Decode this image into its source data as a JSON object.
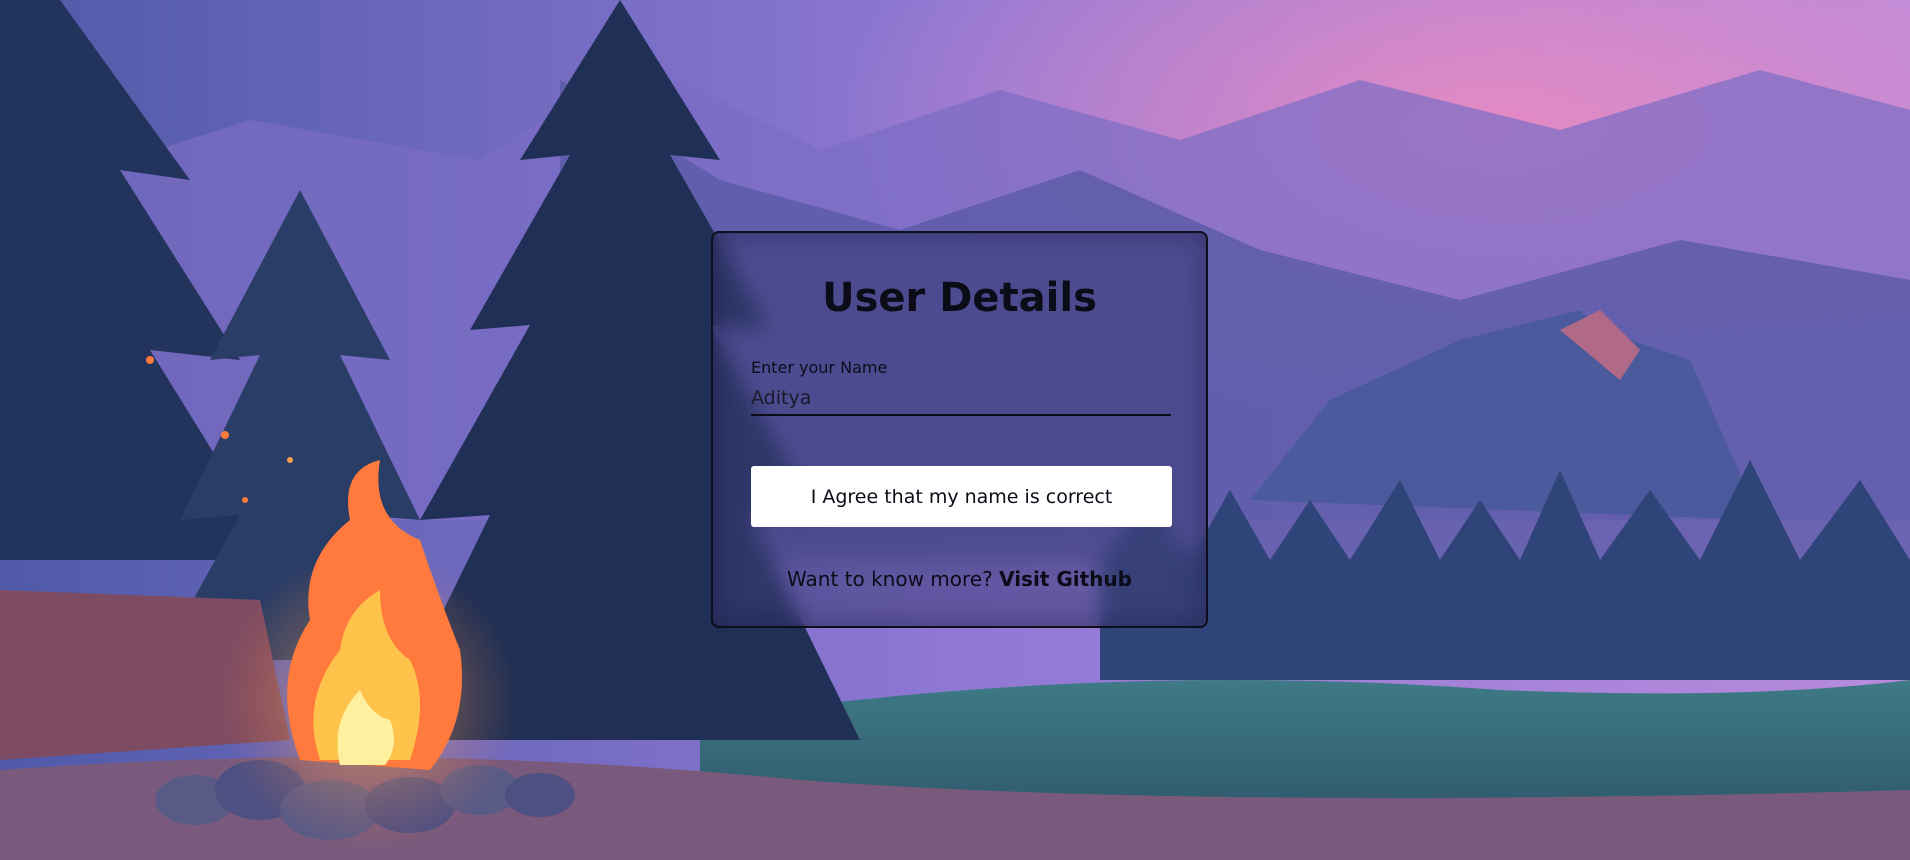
{
  "background": {
    "scene": "night forest campfire with mountains"
  },
  "card": {
    "title": "User Details",
    "name_field": {
      "label": "Enter your Name",
      "value": "Aditya"
    },
    "agree_button": "I Agree that my name is correct",
    "more_text": "Want to know more?",
    "github_link": "Visit Github"
  },
  "colors": {
    "card_border": "#0e0e1c",
    "button_bg": "#ffffff",
    "text": "#0c0c18"
  }
}
